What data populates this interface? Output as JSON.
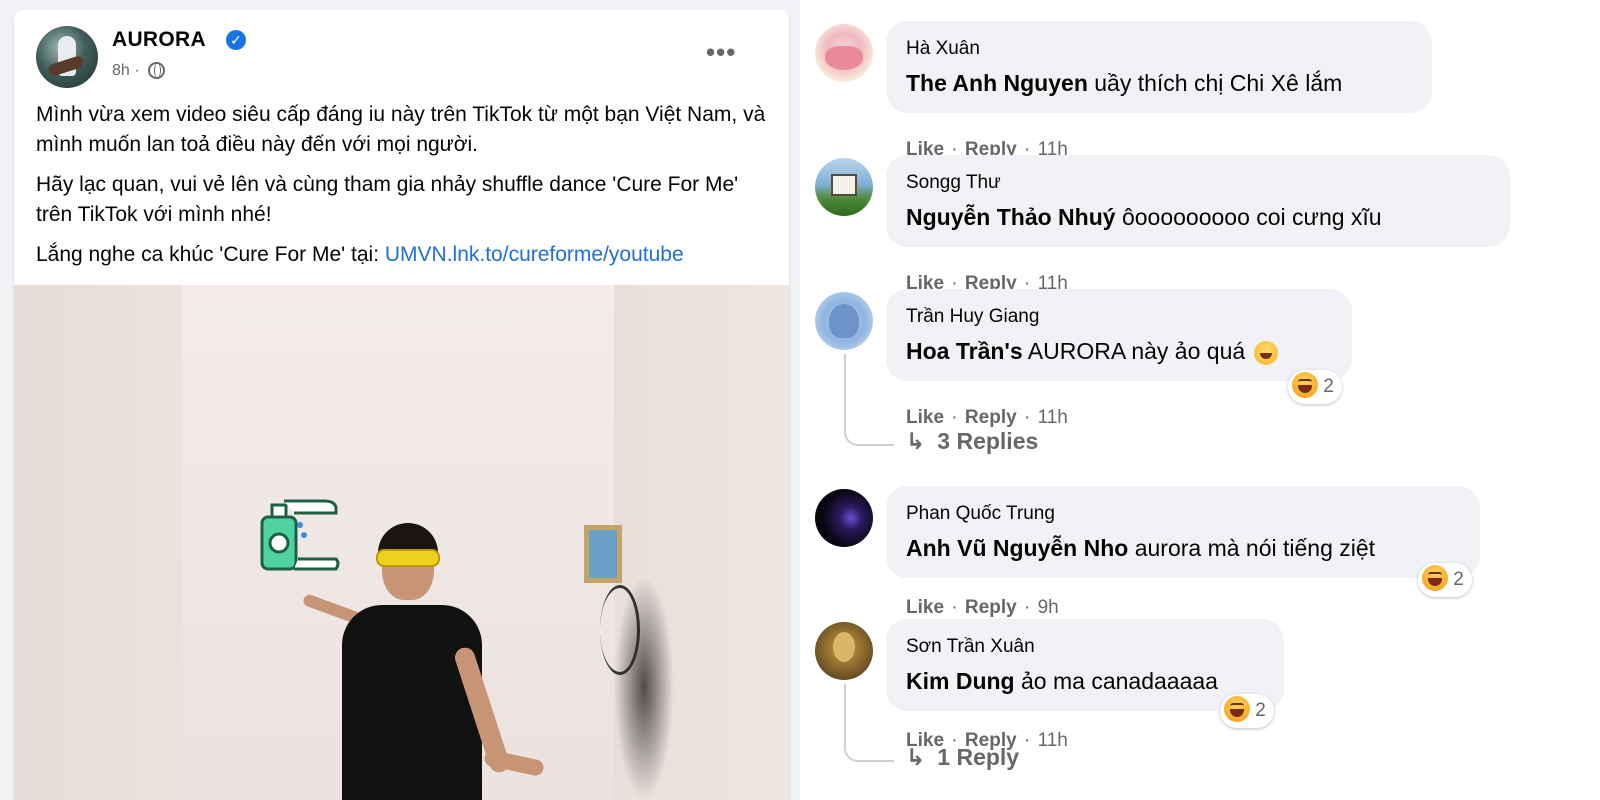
{
  "post": {
    "author": "AURORA",
    "time": "8h ·",
    "paragraphs": [
      "Mình vừa xem video siêu cấp đáng iu này trên TikTok từ một bạn Việt Nam, và mình muốn lan toả điều này đến với mọi người.",
      "Hãy lạc quan, vui vẻ lên và cùng tham gia nhảy shuffle dance 'Cure For Me' trên TikTok với mình nhé!"
    ],
    "listen_prefix": "Lắng nghe ca khúc 'Cure For Me' tại: ",
    "link": "UMVN.lnk.to/cureforme/youtube",
    "more_icon": "•••"
  },
  "actions": {
    "like": "Like",
    "reply": "Reply",
    "sep": " · "
  },
  "comments": [
    {
      "name": "Hà Xuân",
      "tag": "The Anh Nguyen",
      "text": " uầy thích chị Chi Xê lắm",
      "time": "11h"
    },
    {
      "name": "Songg Thư",
      "tag": "Nguyễn Thảo Nhuý",
      "text": " ôooooooooo coi cưng xĩu",
      "time": "11h"
    },
    {
      "name": "Trần Huy Giang",
      "tag": "Hoa Trần's",
      "text": " AURORA này ảo quá ",
      "time": "11h",
      "reaction_count": "2",
      "replies": "3 Replies"
    },
    {
      "name": "Phan Quốc Trung",
      "tag": "Anh Vũ Nguyễn Nho",
      "text": " aurora mà nói tiếng ziệt",
      "time": "9h",
      "reaction_count": "2"
    },
    {
      "name": "Sơn Trần Xuân",
      "tag": "Kim Dung",
      "text": " ảo ma canadaaaaa",
      "time": "11h",
      "reaction_count": "2",
      "replies": "1 Reply"
    }
  ],
  "icons": {
    "reply_arrow": "↳",
    "verified": "✓"
  },
  "colors": {
    "link": "#216fdb",
    "bubble": "#f0f2f5",
    "verified": "#1b74e4",
    "secondary_text": "#65676b"
  }
}
